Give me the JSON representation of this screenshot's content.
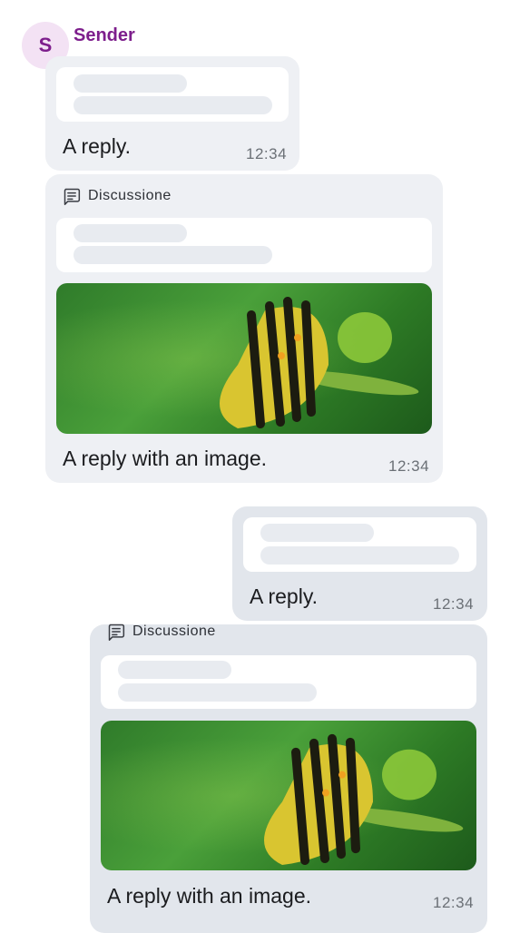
{
  "sender": {
    "initial": "S",
    "name": "Sender"
  },
  "messages": [
    {
      "text": "A reply.",
      "time": "12:34"
    },
    {
      "thread_label": "Discussione",
      "text": "A reply with an image.",
      "time": "12:34",
      "image": "caterpillar-photo"
    },
    {
      "text": "A reply.",
      "time": "12:34"
    },
    {
      "thread_label": "Discussione",
      "text": "A reply with an image.",
      "time": "12:34",
      "image": "caterpillar-photo"
    }
  ],
  "colors": {
    "sender_accent": "#7d1e8c",
    "incoming_bubble": "#eef0f4",
    "outgoing_bubble": "#e2e6ec"
  },
  "icons": {
    "thread": "thread-icon",
    "avatar": "avatar"
  }
}
